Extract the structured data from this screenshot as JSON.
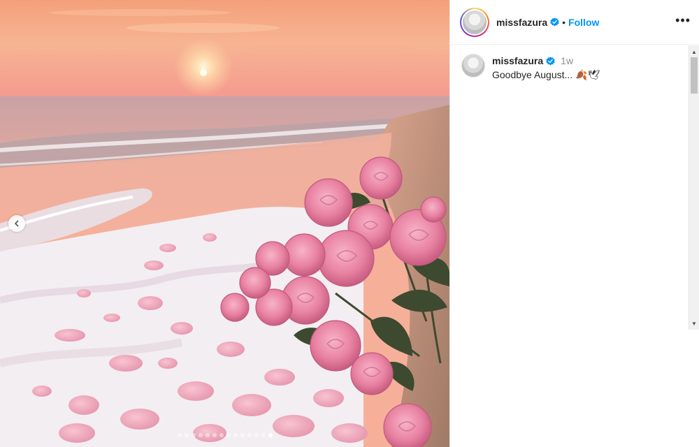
{
  "post": {
    "username": "missfazura",
    "verified": true,
    "follow_label": "Follow",
    "separator": "•",
    "more_label": "•••"
  },
  "caption": {
    "username": "missfazura",
    "time": "1w",
    "text": "Goodbye August... 🍂🕊"
  },
  "carousel": {
    "total_slides": 14,
    "active_index": 13
  },
  "colors": {
    "accent": "#0095f6",
    "verified_badge": "#0095f6",
    "text": "#262626",
    "muted": "#8e8e8e"
  },
  "icons": {
    "prev": "chevron-left-icon",
    "verified": "verified-badge-icon",
    "more": "more-horizontal-icon"
  }
}
